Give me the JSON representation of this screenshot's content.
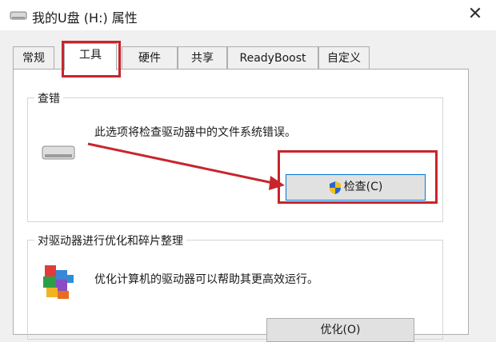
{
  "window": {
    "title": "我的U盘 (H:) 属性",
    "close_glyph": "✕"
  },
  "tabs": [
    {
      "label": "常规",
      "active": false
    },
    {
      "label": "工具",
      "active": true
    },
    {
      "label": "硬件",
      "active": false
    },
    {
      "label": "共享",
      "active": false
    },
    {
      "label": "ReadyBoost",
      "active": false
    },
    {
      "label": "自定义",
      "active": false
    }
  ],
  "error_check": {
    "group_title": "查错",
    "description": "此选项将检查驱动器中的文件系统错误。",
    "button_label": "检查(C)",
    "icon": "drive-icon",
    "button_icon": "uac-shield-icon"
  },
  "optimize": {
    "group_title": "对驱动器进行优化和碎片整理",
    "description": "优化计算机的驱动器可以帮助其更高效运行。",
    "button_label": "优化(O)",
    "icon": "defrag-icon"
  },
  "colors": {
    "annotation_red": "#c8252c",
    "focus_blue": "#0078d7",
    "window_bg": "#f0f0f0"
  }
}
